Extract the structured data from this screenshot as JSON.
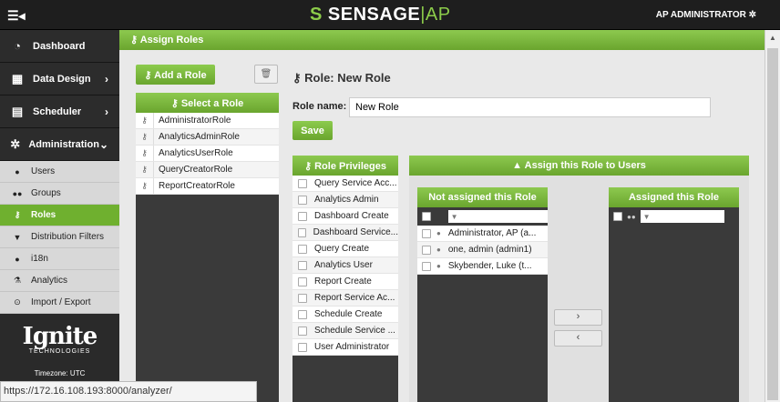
{
  "topbar": {
    "menu_icon": "☰◂",
    "logo_mark": "S",
    "logo_main": "SENSAGE",
    "logo_sep": "|",
    "logo_ap": "AP",
    "user": "AP ADMINISTRATOR",
    "gear": "✲"
  },
  "sidebar": {
    "main": [
      {
        "icon": "◔",
        "label": "Dashboard",
        "arrow": ""
      },
      {
        "icon": "▦",
        "label": "Data Design",
        "arrow": "›"
      },
      {
        "icon": "▤",
        "label": "Scheduler",
        "arrow": "›"
      },
      {
        "icon": "✲",
        "label": "Administration",
        "arrow": "⌄"
      }
    ],
    "sub": [
      {
        "icon": "●",
        "label": "Users"
      },
      {
        "icon": "●●",
        "label": "Groups"
      },
      {
        "icon": "⚷",
        "label": "Roles"
      },
      {
        "icon": "▼",
        "label": "Distribution Filters"
      },
      {
        "icon": "●",
        "label": "i18n"
      },
      {
        "icon": "⚗",
        "label": "Analytics"
      },
      {
        "icon": "⊙",
        "label": "Import / Export"
      }
    ],
    "brand": "Ignite",
    "brand_sub": "TECHNOLOGIES",
    "timezone": "Timezone: UTC"
  },
  "header": {
    "title": "⚷  Assign Roles"
  },
  "left": {
    "add_button": "⚷ Add a Role",
    "trash": "🗑",
    "select_header": "⚷ Select a Role",
    "roles": [
      "AdministratorRole",
      "AnalyticsAdminRole",
      "AnalyticsUserRole",
      "QueryCreatorRole",
      "ReportCreatorRole"
    ],
    "role_icon": "⚷"
  },
  "form": {
    "title": "⚷ Role: New Role",
    "name_label": "Role name:",
    "name_value": "New Role",
    "save": "Save"
  },
  "privileges": {
    "header": "⚷ Role Privileges",
    "items": [
      "Query Service Acc...",
      "Analytics Admin",
      "Dashboard Create",
      "Dashboard Service...",
      "Query Create",
      "Analytics User",
      "Report Create",
      "Report Service Ac...",
      "Schedule Create",
      "Schedule Service ...",
      "User Administrator"
    ]
  },
  "assign": {
    "header": "▲ Assign this Role to Users",
    "not_assigned": "Not assigned this Role",
    "assigned": "Assigned this Role",
    "filter_icon": "▼",
    "users": [
      "Administrator, AP (a...",
      "one, admin (admin1)",
      "Skybender, Luke (t..."
    ],
    "move_right": "›",
    "move_left": "‹"
  },
  "status_url": "https://172.16.108.193:8000/analyzer/"
}
